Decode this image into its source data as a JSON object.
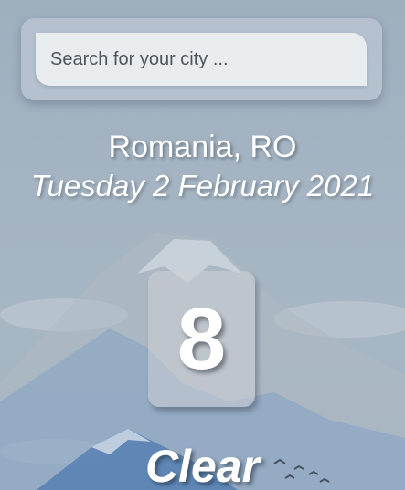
{
  "search": {
    "placeholder": "Search for your city ..."
  },
  "location": {
    "label": "Romania, RO"
  },
  "date": {
    "label": "Tuesday 2 February 2021"
  },
  "weather": {
    "temperature": "8",
    "condition": "Clear"
  },
  "theme": {
    "background": "#a5b4c2",
    "text": "#ffffff",
    "search_bg": "#e9ecef",
    "mountain_blue": "#4d7ab0"
  }
}
